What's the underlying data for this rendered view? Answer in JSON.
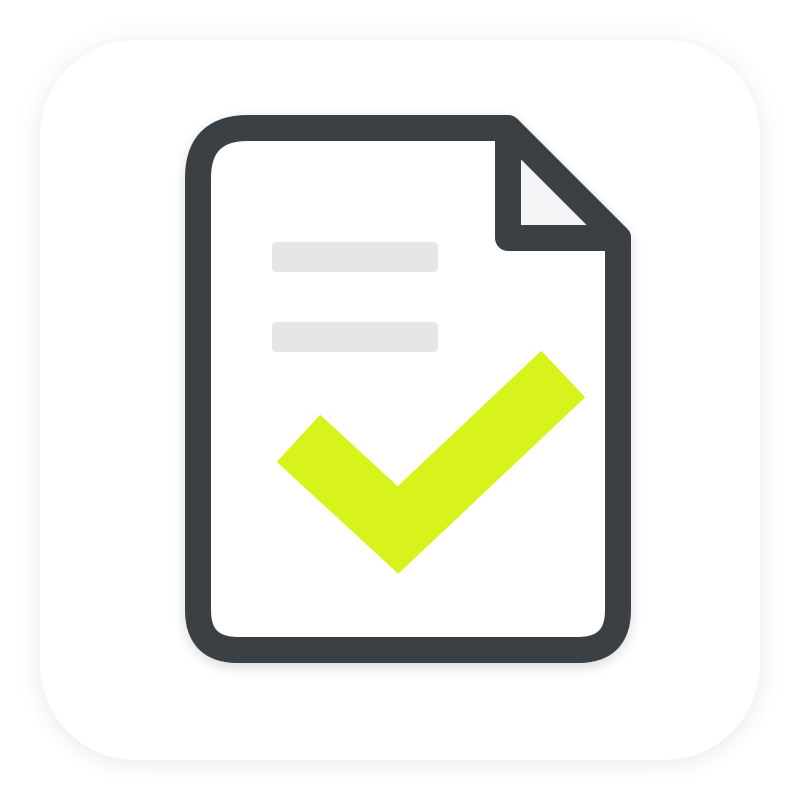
{
  "icon": {
    "name": "document-check-icon",
    "colors": {
      "background": "#ffffff",
      "outline": "#3b4045",
      "paper": "#ffffff",
      "text_lines": "#e6e6e6",
      "checkmark": "#d8f21c"
    }
  }
}
